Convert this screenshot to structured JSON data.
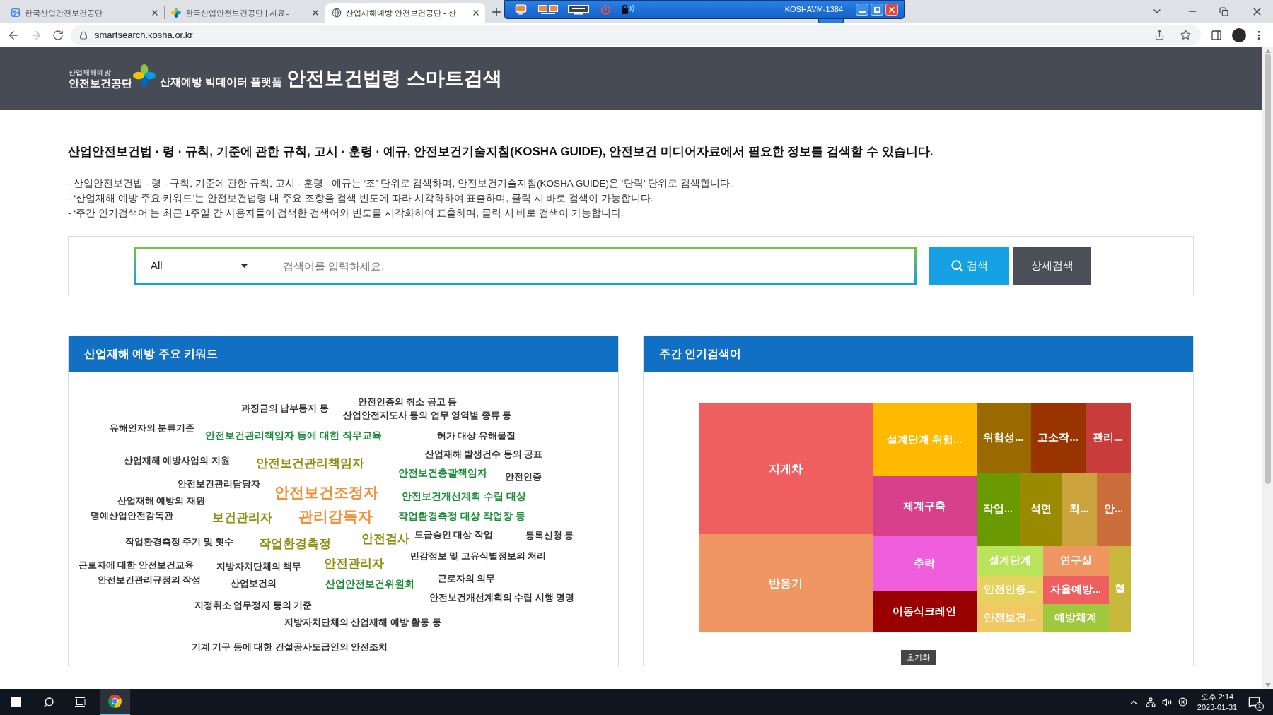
{
  "browser": {
    "tabs": [
      {
        "title": "한국산업안전보건공단",
        "selected": false
      },
      {
        "title": "한국산업안전보건공단 | 자료마",
        "selected": false
      },
      {
        "title": "산업재해예방 안전보건공단 - 산",
        "selected": true
      }
    ],
    "url": "smartsearch.kosha.or.kr"
  },
  "remote_toolbar": {
    "host": "KOSHAVM-1384"
  },
  "header": {
    "org_tagline": "산업재해예방",
    "org_name": "안전보건공단",
    "platform": "산재예방 빅데이터 플랫폼",
    "title": "안전보건법령 스마트검색"
  },
  "intro": {
    "headline": "산업안전보건법 · 령 · 규칙, 기준에 관한 규칙, 고시 · 훈령 · 예규, 안전보건기술지침(KOSHA GUIDE), 안전보건 미디어자료에서 필요한 정보를 검색할 수 있습니다.",
    "notes": [
      "- 산업안전보건법 · 령 · 규칙, 기준에 관한 규칙, 고시 · 훈령 · 예규는 ‘조’ 단위로 검색하며, 안전보건기술지침(KOSHA GUIDE)은 ‘단락’ 단위로 검색합니다.",
      "- ‘산업재해 예방 주요 키워드’는 안전보건법령 내 주요 조항을 검색 빈도에 따라 시각화하여 표출하며, 클릭 시 바로 검색이 가능합니다.",
      "- ‘주간 인기검색어’는 최근 1주일 간 사용자들이 검색한 검색어와 빈도를 시각화하여 표출하며, 클릭 시 바로 검색이 가능합니다."
    ]
  },
  "search": {
    "scope": "All",
    "placeholder": "검색어를 입력하세요.",
    "buttons": [
      {
        "kind": "search",
        "label": "검색"
      },
      {
        "kind": "advanced",
        "label": "상세검색"
      }
    ]
  },
  "keyword_panel": {
    "title": "산업재해 예방 주요 키워드",
    "keywords": [
      {
        "text": "과징금의 납부통지 등",
        "kind": "small",
        "color": "#333333"
      },
      {
        "text": "안전인증의 취소 공고 등",
        "kind": "small",
        "color": "#333333"
      },
      {
        "text": "산업안전지도사 등의 업무 영역별 종류 등",
        "kind": "small",
        "color": "#333333"
      },
      {
        "text": "유해인자의 분류기준",
        "kind": "small",
        "color": "#333333"
      },
      {
        "text": "안전보건관리책임자 등에 대한 직무교육",
        "kind": "medium",
        "color": "#1e8c3a"
      },
      {
        "text": "허가 대상 유해물질",
        "kind": "small",
        "color": "#333333"
      },
      {
        "text": "산업재해 예방사업의 지원",
        "kind": "small",
        "color": "#333333"
      },
      {
        "text": "안전보건관리책임자",
        "kind": "large",
        "color": "#8e8e10"
      },
      {
        "text": "산업재해 발생건수 등의 공표",
        "kind": "small",
        "color": "#333333"
      },
      {
        "text": "안전보건총괄책임자",
        "kind": "medium",
        "color": "#1e8c3a"
      },
      {
        "text": "안전인증",
        "kind": "small",
        "color": "#333333"
      },
      {
        "text": "안전보건관리담당자",
        "kind": "small",
        "color": "#333333"
      },
      {
        "text": "안전보건조정자",
        "kind": "xlarge",
        "color": "#f0913c"
      },
      {
        "text": "안전보건개선계획 수립 대상",
        "kind": "medium",
        "color": "#1e8c3a"
      },
      {
        "text": "산업재해 예방의 재원",
        "kind": "small",
        "color": "#333333"
      },
      {
        "text": "명예산업안전감독관",
        "kind": "small",
        "color": "#333333"
      },
      {
        "text": "보건관리자",
        "kind": "large",
        "color": "#8e8e10"
      },
      {
        "text": "관리감독자",
        "kind": "xlarge",
        "color": "#f0913c"
      },
      {
        "text": "작업환경측정 대상 작업장 등",
        "kind": "medium",
        "color": "#1e8c3a"
      },
      {
        "text": "작업환경측정 주기 및 횟수",
        "kind": "small",
        "color": "#333333"
      },
      {
        "text": "작업환경측정",
        "kind": "large",
        "color": "#8e8e10"
      },
      {
        "text": "안전검사",
        "kind": "large",
        "color": "#8e8e10"
      },
      {
        "text": "도급승인 대상 작업",
        "kind": "small",
        "color": "#333333"
      },
      {
        "text": "등록신청 등",
        "kind": "small",
        "color": "#333333"
      },
      {
        "text": "민감정보 및 고유식별정보의 처리",
        "kind": "small",
        "color": "#333333"
      },
      {
        "text": "근로자에 대한 안전보건교육",
        "kind": "small",
        "color": "#333333"
      },
      {
        "text": "지방자치단체의 책무",
        "kind": "small",
        "color": "#333333"
      },
      {
        "text": "안전관리자",
        "kind": "large",
        "color": "#8e8e10"
      },
      {
        "text": "안전보건관리규정의 작성",
        "kind": "small",
        "color": "#333333"
      },
      {
        "text": "산업보건의",
        "kind": "small",
        "color": "#333333"
      },
      {
        "text": "산업안전보건위원회",
        "kind": "medium",
        "color": "#1e8c3a"
      },
      {
        "text": "근로자의 의무",
        "kind": "small",
        "color": "#333333"
      },
      {
        "text": "안전보건개선계획의 수립 시행 명령",
        "kind": "small",
        "color": "#333333"
      },
      {
        "text": "지정취소 업무정지 등의 기준",
        "kind": "small",
        "color": "#333333"
      },
      {
        "text": "지방자치단체의 산업재해 예방 활동 등",
        "kind": "small",
        "color": "#333333"
      },
      {
        "text": "기계 기구 등에 대한 건설공사도급인의 안전조치",
        "kind": "small",
        "color": "#333333"
      }
    ]
  },
  "popular_panel": {
    "title": "주간 인기검색어",
    "cells": [
      {
        "label": "지게차",
        "color": "#ef5f5f"
      },
      {
        "label": "반응기",
        "color": "#f09663"
      },
      {
        "label": "설계단계 위험...",
        "color": "#ffba00"
      },
      {
        "label": "체계구축",
        "color": "#d8408b"
      },
      {
        "label": "추락",
        "color": "#f05edd"
      },
      {
        "label": "이동식크레인",
        "color": "#990000"
      },
      {
        "label": "위험성...",
        "color": "#9a6a00"
      },
      {
        "label": "고소작...",
        "color": "#993300"
      },
      {
        "label": "관리...",
        "color": "#c83c3c"
      },
      {
        "label": "작업...",
        "color": "#6a9a00"
      },
      {
        "label": "석면",
        "color": "#9a8a00"
      },
      {
        "label": "최...",
        "color": "#cca23c"
      },
      {
        "label": "안...",
        "color": "#cc6e3c"
      },
      {
        "label": "설계단계",
        "color": "#b8e35a"
      },
      {
        "label": "연구실",
        "color": "#f09663"
      },
      {
        "label": "안전인증...",
        "color": "#e5d25f"
      },
      {
        "label": "자율예방...",
        "color": "#ef5f5f"
      },
      {
        "label": "안전보건...",
        "color": "#f0c864"
      },
      {
        "label": "예방체계",
        "color": "#a0c83c"
      },
      {
        "label": "혈",
        "color": "#c8b83c"
      }
    ],
    "reset_button": "초기화"
  },
  "taskbar": {
    "time": "오후 2:14",
    "date": "2023-01-31",
    "notifications": "1"
  }
}
